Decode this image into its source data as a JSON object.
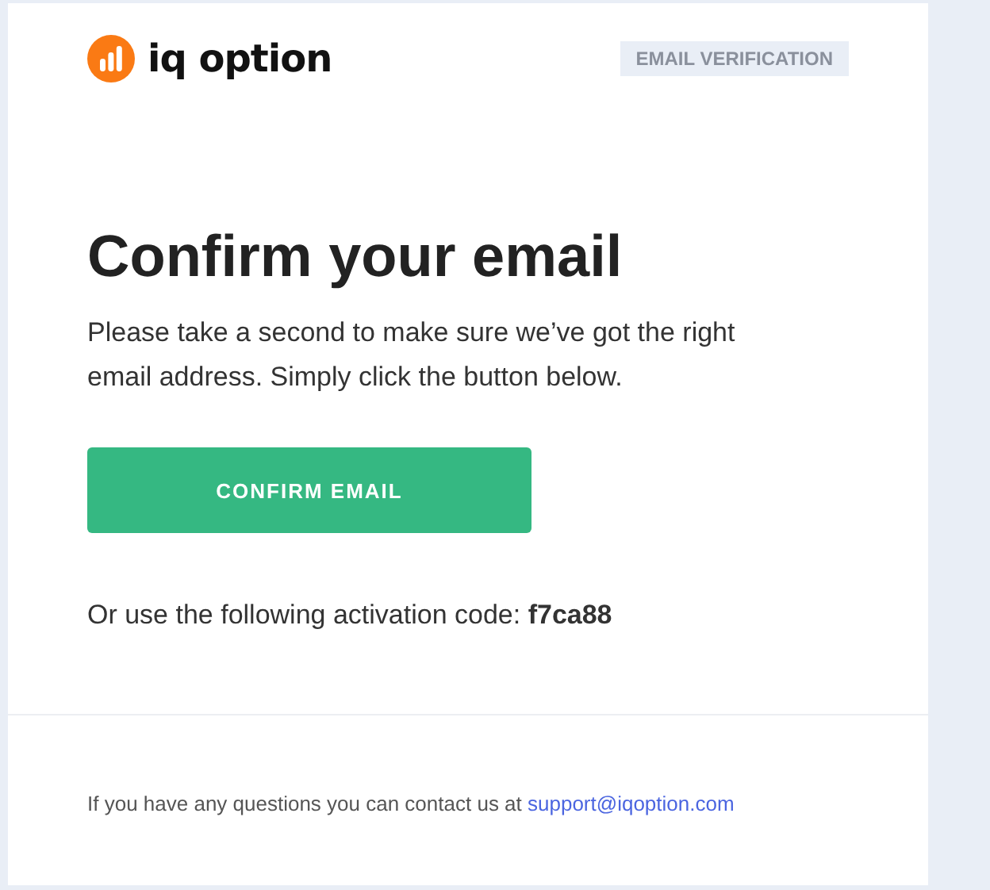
{
  "header": {
    "logo_text": "iq option",
    "badge": "EMAIL VERIFICATION"
  },
  "title": "Confirm your email",
  "intro": "Please take a second to make sure we’ve got the right email address. Simply click the button below.",
  "button": "CONFIRM EMAIL",
  "code_line": "Or use the following activation code: **f7ca88**",
  "footer": {
    "text": "If you have any questions you can contact us at",
    "link": "support@iqoption.com"
  }
}
